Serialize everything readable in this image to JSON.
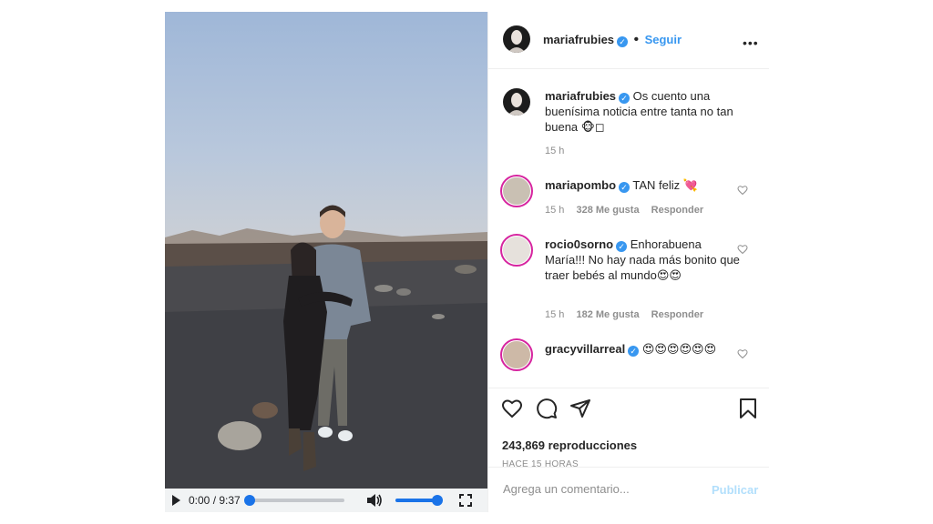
{
  "post": {
    "author": "mariafrubies",
    "follow_label": "Seguir",
    "more_label": "•••",
    "caption": "Os cuento una buenísima noticia entre tanta no tan buena 🐵◻",
    "caption_time": "15 h"
  },
  "comments": [
    {
      "user": "mariapombo",
      "text": "TAN feliz 💘",
      "time": "15 h",
      "likes": "328 Me gusta",
      "reply": "Responder"
    },
    {
      "user": "rocio0sorno",
      "text": "Enhorabuena María!!! No hay nada más bonito que traer bebés al mundo😍😍",
      "time": "15 h",
      "likes": "182 Me gusta",
      "reply": "Responder"
    },
    {
      "user": "gracyvillarreal",
      "text": "😍😍😍😍😍😍"
    }
  ],
  "stats": {
    "views": "243,869 reproducciones",
    "ago": "HACE 15 HORAS"
  },
  "comment_box": {
    "placeholder": "Agrega un comentario...",
    "publish_label": "Publicar"
  },
  "video": {
    "time": "0:00 / 9:37",
    "progress": 0,
    "volume": 1
  },
  "icons": {
    "like": "heart-icon",
    "comment": "comment-icon",
    "share": "share-icon",
    "save": "bookmark-icon",
    "play": "play-icon",
    "volume": "volume-icon",
    "fullscreen": "fullscreen-icon"
  },
  "colors": {
    "link_blue": "#3897f0",
    "publish_disabled": "#b2dffc",
    "muted_text": "#8e8e8e",
    "player_blue": "#1a73e8"
  }
}
